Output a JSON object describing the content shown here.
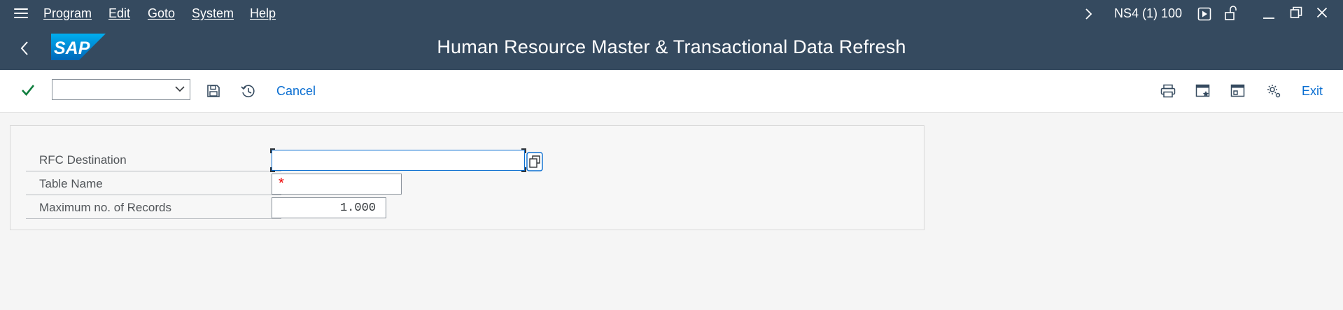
{
  "menu": {
    "items": [
      {
        "label": "Program"
      },
      {
        "label": "Edit"
      },
      {
        "label": "Goto"
      },
      {
        "label": "System"
      },
      {
        "label": "Help"
      }
    ],
    "system_info": "NS4 (1) 100"
  },
  "header": {
    "title": "Human Resource Master & Transactional Data Refresh",
    "logo_text": "SAP"
  },
  "toolbar": {
    "command_field_value": "",
    "cancel_label": "Cancel",
    "exit_label": "Exit"
  },
  "form": {
    "fields": [
      {
        "label": "RFC Destination",
        "value": ""
      },
      {
        "label": "Table Name",
        "value": "",
        "required_mark": "*"
      },
      {
        "label": "Maximum no. of Records",
        "value": "1.000"
      }
    ]
  },
  "colors": {
    "shell": "#354a5f",
    "accent": "#0a6ed1",
    "confirm": "#107e3e",
    "required": "#e00000"
  }
}
